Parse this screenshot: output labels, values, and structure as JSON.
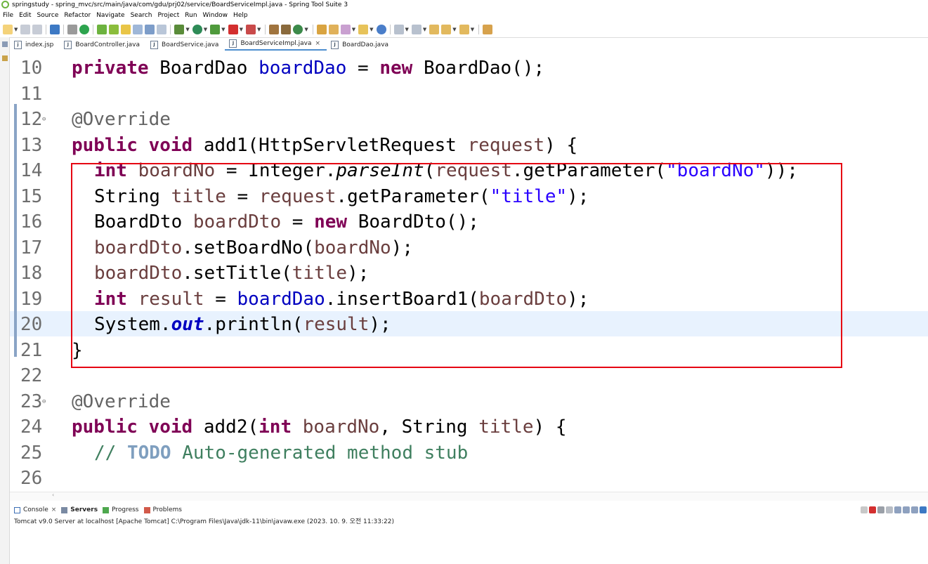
{
  "window": {
    "title": "springstudy - spring_mvc/src/main/java/com/gdu/prj02/service/BoardServiceImpl.java - Spring Tool Suite 3"
  },
  "menu": [
    "File",
    "Edit",
    "Source",
    "Refactor",
    "Navigate",
    "Search",
    "Project",
    "Run",
    "Window",
    "Help"
  ],
  "tabs": [
    {
      "label": "index.jsp",
      "icon": "jsp-file-icon",
      "active": false
    },
    {
      "label": "BoardController.java",
      "icon": "java-file-icon",
      "active": false
    },
    {
      "label": "BoardService.java",
      "icon": "java-file-icon",
      "active": false
    },
    {
      "label": "BoardServiceImpl.java",
      "icon": "java-file-icon",
      "active": true,
      "close": "×"
    },
    {
      "label": "BoardDao.java",
      "icon": "java-file-icon",
      "active": false
    }
  ],
  "editor": {
    "lines": [
      {
        "no": "10",
        "code": "private BoardDao boardDao = new BoardDao();"
      },
      {
        "no": "11",
        "code": ""
      },
      {
        "no": "12",
        "code": "@Override"
      },
      {
        "no": "13",
        "code": "public void add1(HttpServletRequest request) {"
      },
      {
        "no": "14",
        "code": "int boardNo = Integer.parseInt(request.getParameter(\"boardNo\"));"
      },
      {
        "no": "15",
        "code": "String title = request.getParameter(\"title\");"
      },
      {
        "no": "16",
        "code": "BoardDto boardDto = new BoardDto();"
      },
      {
        "no": "17",
        "code": "boardDto.setBoardNo(boardNo);"
      },
      {
        "no": "18",
        "code": "boardDto.setTitle(title);"
      },
      {
        "no": "19",
        "code": "int result = boardDao.insertBoard1(boardDto);"
      },
      {
        "no": "20",
        "code": "System.out.println(result);"
      },
      {
        "no": "21",
        "code": "}"
      },
      {
        "no": "22",
        "code": ""
      },
      {
        "no": "23",
        "code": "@Override"
      },
      {
        "no": "24",
        "code": "public void add2(int boardNo, String title) {"
      },
      {
        "no": "25",
        "code": "// TODO Auto-generated method stub"
      },
      {
        "no": "26",
        "code": ""
      }
    ],
    "highlight_color": "#e60012",
    "keyword_color": "#7f0055",
    "field_color": "#0000c0",
    "string_color": "#2a00ff",
    "comment_color": "#3f7f5f"
  },
  "console": {
    "tabs": [
      {
        "label": "Console",
        "icon": "console-icon",
        "close": "×"
      },
      {
        "label": "Servers",
        "icon": "servers-icon",
        "active": true
      },
      {
        "label": "Progress",
        "icon": "progress-icon"
      },
      {
        "label": "Problems",
        "icon": "problems-icon"
      }
    ],
    "status": "Tomcat v9.0 Server at localhost [Apache Tomcat] C:\\Program Files\\Java\\jdk-11\\bin\\javaw.exe  (2023. 10. 9. 오전 11:33:22)"
  }
}
